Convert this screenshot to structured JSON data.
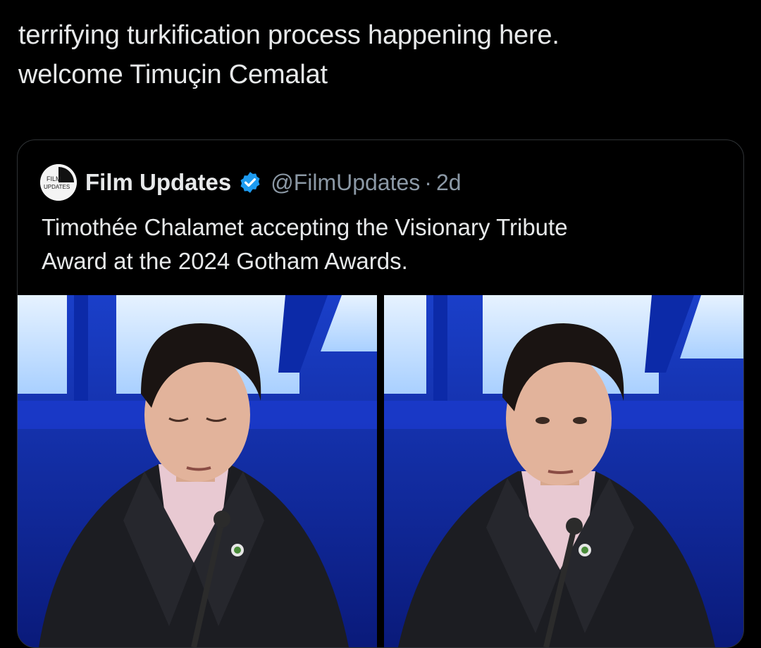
{
  "tweet": {
    "text_lines": [
      "terrifying turkification process happening here.",
      "welcome Timuçin Cemalat"
    ]
  },
  "quote": {
    "avatar_text_top": "FILM",
    "avatar_text_bottom": "UPDATES",
    "display_name": "Film Updates",
    "verified_icon": "verified-badge-icon",
    "handle": "@FilmUpdates",
    "separator": "·",
    "age": "2d",
    "text_lines": [
      "Timothée Chalamet accepting the Visionary Tribute",
      "Award at the 2024 Gotham Awards."
    ],
    "media": [
      {
        "label": "photo-1"
      },
      {
        "label": "photo-2"
      }
    ]
  },
  "colors": {
    "background": "#000000",
    "text": "#e7e9ea",
    "secondary": "#8b98a5",
    "border": "#2f3336",
    "verified": "#1d9bf0",
    "stage_blue": "#1237b8",
    "screen_light": "#cfe6ff"
  }
}
